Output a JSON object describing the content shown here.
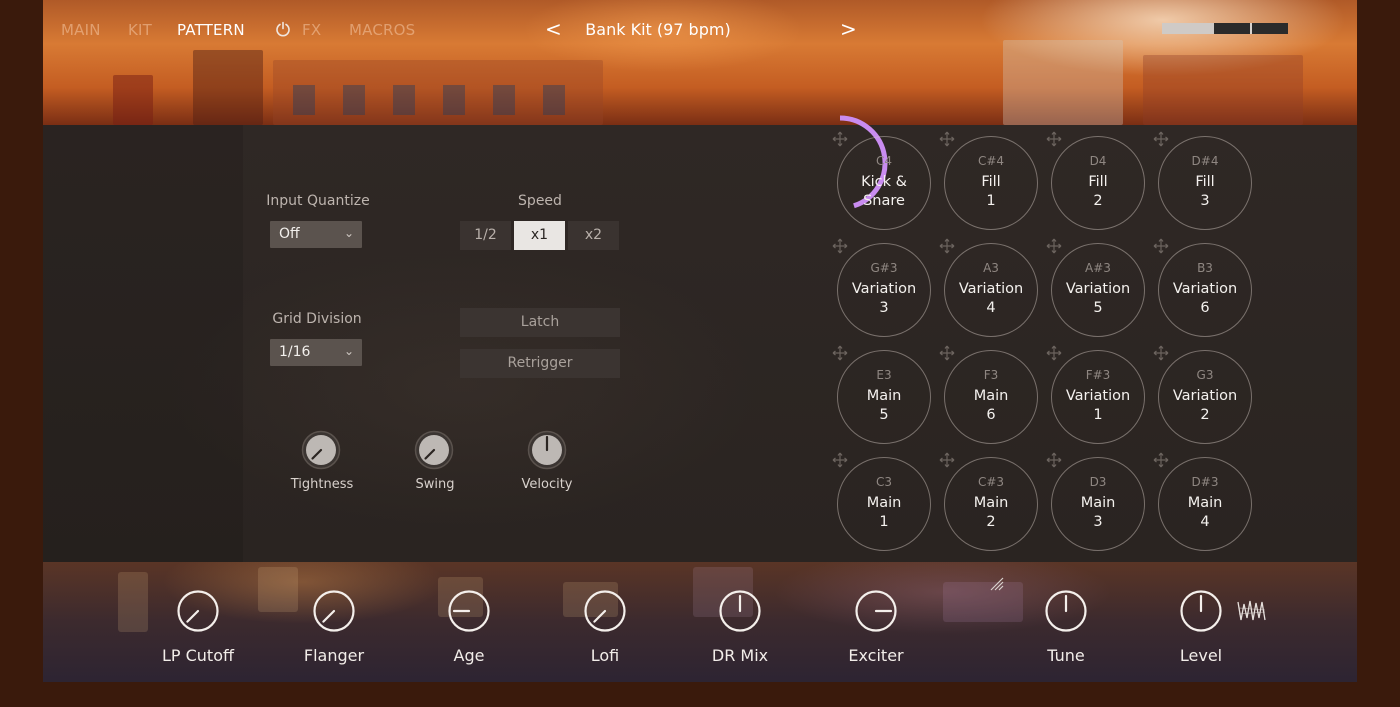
{
  "nav": {
    "tabs": [
      {
        "label": "MAIN",
        "state": "inactive"
      },
      {
        "label": "KIT",
        "state": "inactive"
      },
      {
        "label": "PATTERN",
        "state": "active"
      },
      {
        "label": "FX",
        "state": "inactive"
      },
      {
        "label": "MACROS",
        "state": "inactive"
      }
    ],
    "fx_icon": "power-icon",
    "prev_label": "<",
    "next_label": ">",
    "bank_title": "Bank Kit (97 bpm)"
  },
  "pattern": {
    "input_quantize": {
      "label": "Input Quantize",
      "value": "Off"
    },
    "grid_division": {
      "label": "Grid Division",
      "value": "1/16"
    },
    "speed": {
      "label": "Speed",
      "options": [
        "1/2",
        "x1",
        "x2"
      ],
      "selected": "x1"
    },
    "latch_label": "Latch",
    "retrigger_label": "Retrigger",
    "knobs": [
      {
        "label": "Tightness"
      },
      {
        "label": "Swing"
      },
      {
        "label": "Velocity"
      }
    ]
  },
  "pads": [
    {
      "note": "C4",
      "name_line1": "Kick &",
      "name_line2": "Snare"
    },
    {
      "note": "C#4",
      "name_line1": "Fill",
      "name_line2": "1"
    },
    {
      "note": "D4",
      "name_line1": "Fill",
      "name_line2": "2"
    },
    {
      "note": "D#4",
      "name_line1": "Fill",
      "name_line2": "3"
    },
    {
      "note": "G#3",
      "name_line1": "Variation",
      "name_line2": "3"
    },
    {
      "note": "A3",
      "name_line1": "Variation",
      "name_line2": "4"
    },
    {
      "note": "A#3",
      "name_line1": "Variation",
      "name_line2": "5"
    },
    {
      "note": "B3",
      "name_line1": "Variation",
      "name_line2": "6"
    },
    {
      "note": "E3",
      "name_line1": "Main",
      "name_line2": "5"
    },
    {
      "note": "F3",
      "name_line1": "Main",
      "name_line2": "6"
    },
    {
      "note": "F#3",
      "name_line1": "Variation",
      "name_line2": "1"
    },
    {
      "note": "G3",
      "name_line1": "Variation",
      "name_line2": "2"
    },
    {
      "note": "C3",
      "name_line1": "Main",
      "name_line2": "1"
    },
    {
      "note": "C#3",
      "name_line1": "Main",
      "name_line2": "2"
    },
    {
      "note": "D3",
      "name_line1": "Main",
      "name_line2": "3"
    },
    {
      "note": "D#3",
      "name_line1": "Main",
      "name_line2": "4"
    }
  ],
  "active_pad_progress": 0.45,
  "macros": [
    {
      "label": "LP Cutoff"
    },
    {
      "label": "Flanger"
    },
    {
      "label": "Age"
    },
    {
      "label": "Lofi"
    },
    {
      "label": "DR Mix"
    },
    {
      "label": "Exciter"
    },
    {
      "label": "Tune"
    },
    {
      "label": "Level"
    }
  ],
  "colors": {
    "accent_purple": "#c98cf0",
    "active_tab": "#ffffff",
    "inactive_tab": "#a97a60"
  }
}
